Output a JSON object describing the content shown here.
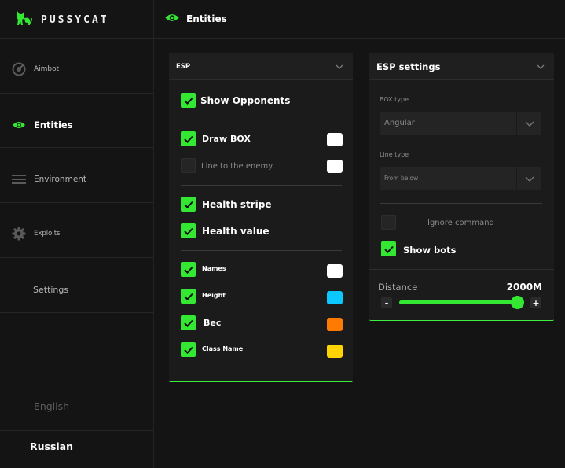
{
  "app": {
    "brand": "PUSSYCAT",
    "accent": "#33e733"
  },
  "sidebar": {
    "items": [
      {
        "label": "Aimbot",
        "icon": "target-icon"
      },
      {
        "label": "Entities",
        "icon": "eye-icon",
        "active": true
      },
      {
        "label": "Environment",
        "icon": "menu-icon"
      },
      {
        "label": "Exploits",
        "icon": "gear-icon"
      },
      {
        "label": "Settings"
      }
    ],
    "languages": [
      {
        "label": "English",
        "active": false
      },
      {
        "label": "Russian",
        "active": true
      }
    ]
  },
  "header": {
    "title": "Entities",
    "icon": "eye-icon"
  },
  "esp_panel": {
    "title": "ESP",
    "show_opponents": {
      "label": "Show Opponents",
      "checked": true
    },
    "draw_box": {
      "label": "Draw BOX",
      "checked": true,
      "color": "#ffffff"
    },
    "line_to_enemy": {
      "label": "Line to the enemy",
      "checked": false,
      "color": "#ffffff"
    },
    "health_stripe": {
      "label": "Health stripe",
      "checked": true
    },
    "health_value": {
      "label": "Health value",
      "checked": true
    },
    "names": {
      "label": "Names",
      "checked": true,
      "color": "#ffffff"
    },
    "height": {
      "label": "Height",
      "checked": true,
      "color": "#0bc8ff"
    },
    "bec": {
      "label": "Bec",
      "checked": true,
      "color": "#ff7a00"
    },
    "class_name": {
      "label": "Class Name",
      "checked": true,
      "color": "#ffd400"
    }
  },
  "esp_settings": {
    "title": "ESP settings",
    "box_type": {
      "label": "BOX type",
      "value": "Angular"
    },
    "line_type": {
      "label": "Line type",
      "value": "From below"
    },
    "ignore_command": {
      "label": "Ignore command",
      "checked": false
    },
    "show_bots": {
      "label": "Show bots",
      "checked": true
    },
    "distance": {
      "label": "Distance",
      "value_text": "2000M",
      "level": 1.0,
      "minus": "-",
      "plus": "+"
    }
  }
}
